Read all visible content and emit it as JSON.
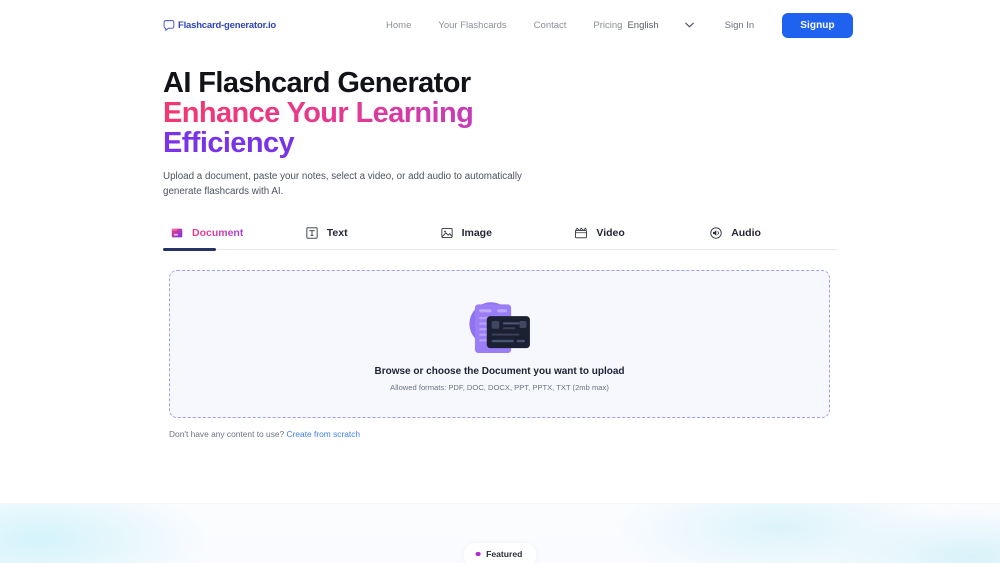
{
  "header": {
    "brand": {
      "name": "Flashcard-generator.io",
      "icon": "speech-bubble-logo-icon"
    },
    "nav": [
      {
        "label": "Home"
      },
      {
        "label": "Your Flashcards"
      },
      {
        "label": "Contact"
      },
      {
        "label": "Pricing"
      }
    ],
    "language": {
      "value": "English",
      "icon": "chevron-down-icon"
    },
    "sign_in_label": "Sign In",
    "signup_label": "Signup",
    "signup_color": "#1f62f0"
  },
  "hero": {
    "title_line1": "AI Flashcard Generator",
    "title_line2": "Enhance Your Learning",
    "title_line3": "Efficiency",
    "subtitle": "Upload a document, paste your notes, select a video, or add audio to automatically generate flashcards with AI.",
    "gradient_start": "#f4386f",
    "gradient_end": "#6b35e8"
  },
  "tabs": [
    {
      "label": "Document",
      "icon": "document-folder-icon",
      "active": true
    },
    {
      "label": "Text",
      "icon": "text-box-icon",
      "active": false
    },
    {
      "label": "Image",
      "icon": "image-picture-icon",
      "active": false
    },
    {
      "label": "Video",
      "icon": "video-clapperboard-icon",
      "active": false
    },
    {
      "label": "Audio",
      "icon": "audio-speaker-icon",
      "active": false
    }
  ],
  "dropzone": {
    "illustration": "document-card-upload-illustration",
    "title": "Browse or choose the Document you want to upload",
    "formats": "Allowed formats: PDF, DOC, DOCX, PPT, PPTX, TXT (2mb max)",
    "border_color": "#9aa0f5",
    "background": "#f7f8fe"
  },
  "scratch": {
    "prompt": "Don't have any content to use?",
    "link_label": "Create from scratch",
    "link_color": "#3f7ff0"
  },
  "band": {
    "featured_label": "Featured",
    "featured_dot_color": "#b429d6"
  }
}
